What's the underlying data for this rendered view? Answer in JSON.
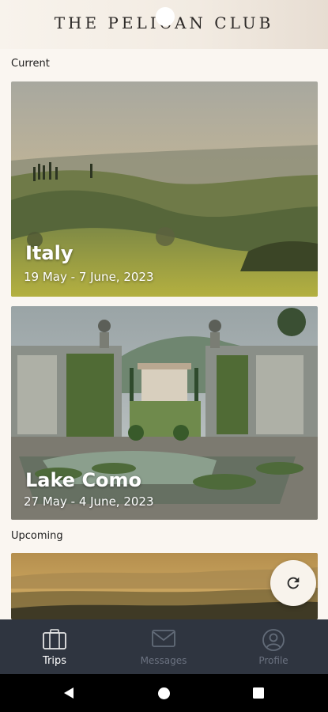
{
  "header": {
    "brand": "THE PELICAN CLUB"
  },
  "sections": {
    "current_label": "Current",
    "upcoming_label": "Upcoming"
  },
  "current_trips": [
    {
      "title": "Italy",
      "dates": "19 May - 7 June, 2023"
    },
    {
      "title": "Lake Como",
      "dates": "27 May - 4 June, 2023"
    }
  ],
  "fab": {
    "icon": "refresh-icon"
  },
  "tabs": [
    {
      "label": "Trips",
      "icon": "suitcase-icon",
      "active": true
    },
    {
      "label": "Messages",
      "icon": "envelope-icon",
      "active": false
    },
    {
      "label": "Profile",
      "icon": "user-icon",
      "active": false
    }
  ],
  "system_nav": {
    "back": "back-icon",
    "home": "home-icon",
    "recents": "recents-icon"
  }
}
